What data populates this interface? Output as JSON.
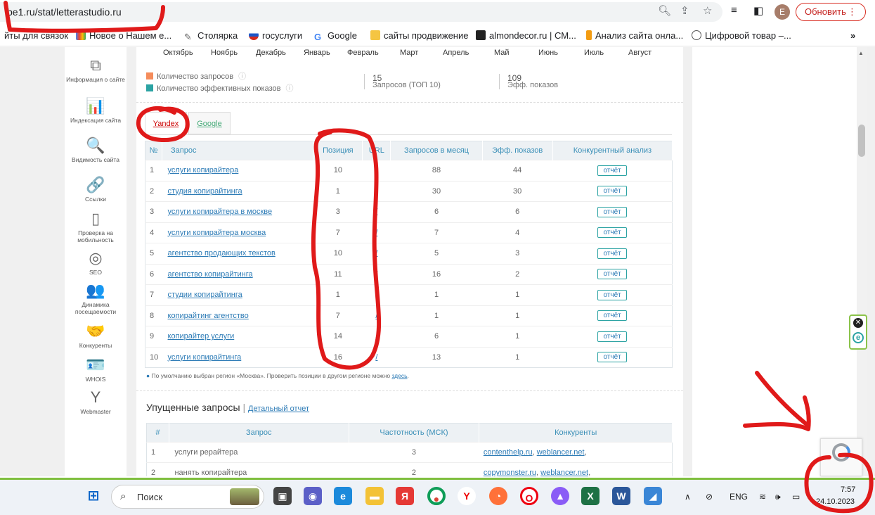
{
  "browser": {
    "url": "be1.ru/stat/letterastudio.ru",
    "avatar_letter": "E",
    "update_label": "Обновить",
    "update_menu_icon": "⋮"
  },
  "bookmarks": [
    {
      "label": "йты для связок",
      "icon": "folder"
    },
    {
      "label": "Новое о Нашем е...",
      "icon": "multicolor"
    },
    {
      "label": "Столярка",
      "icon": "pencil"
    },
    {
      "label": "госуслуги",
      "icon": "flag"
    },
    {
      "label": "Google",
      "icon": "google"
    },
    {
      "label": "сайты продвижение",
      "icon": "folder"
    },
    {
      "label": "almondecor.ru | СМ...",
      "icon": "site"
    },
    {
      "label": "Анализ сайта онла...",
      "icon": "flame"
    },
    {
      "label": "Цифровой товар –...",
      "icon": "circle"
    },
    {
      "label": "»",
      "icon": "more"
    }
  ],
  "sidebar": [
    {
      "label": "Информация о сайте",
      "icon": "⧉",
      "name": "info"
    },
    {
      "label": "Индексация сайта",
      "icon": "📊",
      "name": "indexing"
    },
    {
      "label": "Видимость сайта",
      "icon": "🔍",
      "name": "visibility"
    },
    {
      "label": "Ссылки",
      "icon": "🔗",
      "name": "links"
    },
    {
      "label": "Проверка на мобильность",
      "icon": "▯",
      "name": "mobile"
    },
    {
      "label": "SEO",
      "icon": "◎",
      "name": "seo"
    },
    {
      "label": "Динамика посещаемости",
      "icon": "👥",
      "name": "traffic"
    },
    {
      "label": "Конкуренты",
      "icon": "🤝",
      "name": "competitors"
    },
    {
      "label": "WHOIS",
      "icon": "🪪",
      "name": "whois"
    },
    {
      "label": "Webmaster",
      "icon": "Y",
      "name": "webmaster"
    }
  ],
  "months": [
    "Октябрь",
    "Ноябрь",
    "Декабрь",
    "Январь",
    "Февраль",
    "Март",
    "Апрель",
    "Май",
    "Июнь",
    "Июль",
    "Август"
  ],
  "legend": {
    "requests": "Количество запросов",
    "effective": "Количество эффективных показов",
    "colors": {
      "requests": "#f58c5b",
      "effective": "#2ba3a3"
    }
  },
  "stats": {
    "queries_value": "15",
    "queries_caption": "Запросов (ТОП 10)",
    "shows_value": "109",
    "shows_caption": "Эфф. показов"
  },
  "tabs": {
    "yandex": "Yandex",
    "google": "Google"
  },
  "positions_table": {
    "headers": [
      "№",
      "Запрос",
      "Позиция",
      "URL",
      "Запросов в месяц",
      "Эфф. показов",
      "Конкурентный анализ"
    ],
    "report_label": "отчёт",
    "rows": [
      {
        "n": "1",
        "query": "услуги копирайтера",
        "pos": "10",
        "url": "/",
        "monthly": "88",
        "shows": "44"
      },
      {
        "n": "2",
        "query": "студия копирайтинга",
        "pos": "1",
        "url": "/",
        "monthly": "30",
        "shows": "30"
      },
      {
        "n": "3",
        "query": "услуги копирайтера в москве",
        "pos": "3",
        "url": "/",
        "monthly": "6",
        "shows": "6"
      },
      {
        "n": "4",
        "query": "услуги копирайтера москва",
        "pos": "7",
        "url": "/",
        "monthly": "7",
        "shows": "4"
      },
      {
        "n": "5",
        "query": "агентство продающих текстов",
        "pos": "10",
        "url": "/",
        "monthly": "5",
        "shows": "3"
      },
      {
        "n": "6",
        "query": "агентство копирайтинга",
        "pos": "11",
        "url": "/",
        "monthly": "16",
        "shows": "2"
      },
      {
        "n": "7",
        "query": "студии копирайтинга",
        "pos": "1",
        "url": "/",
        "monthly": "1",
        "shows": "1"
      },
      {
        "n": "8",
        "query": "копирайтинг агентство",
        "pos": "7",
        "url": "/",
        "monthly": "1",
        "shows": "1"
      },
      {
        "n": "9",
        "query": "копирайтер услуги",
        "pos": "14",
        "url": "/",
        "monthly": "6",
        "shows": "1"
      },
      {
        "n": "10",
        "query": "услуги копирайтинга",
        "pos": "16",
        "url": "/",
        "monthly": "13",
        "shows": "1"
      }
    ]
  },
  "region_note": {
    "text": "По умолчанию выбран регион «Москва». Проверить позиции в другом регионе можно",
    "link": "здесь"
  },
  "missed": {
    "title": "Упущенные запросы",
    "detail_link": "Детальный отчет",
    "headers": [
      "#",
      "Запрос",
      "Частотность (МСК)",
      "Конкуренты"
    ],
    "rows": [
      {
        "n": "1",
        "query": "услуги рерайтера",
        "freq": "3",
        "competitors": [
          "contenthelp.ru",
          "weblancer.net"
        ]
      },
      {
        "n": "2",
        "query": "нанять копирайтера",
        "freq": "2",
        "competitors": [
          "copymonster.ru",
          "weblancer.net"
        ]
      }
    ]
  },
  "taskbar": {
    "search_placeholder": "Поиск",
    "lang": "ENG",
    "time": "7:57",
    "date": "24.10.2023"
  }
}
